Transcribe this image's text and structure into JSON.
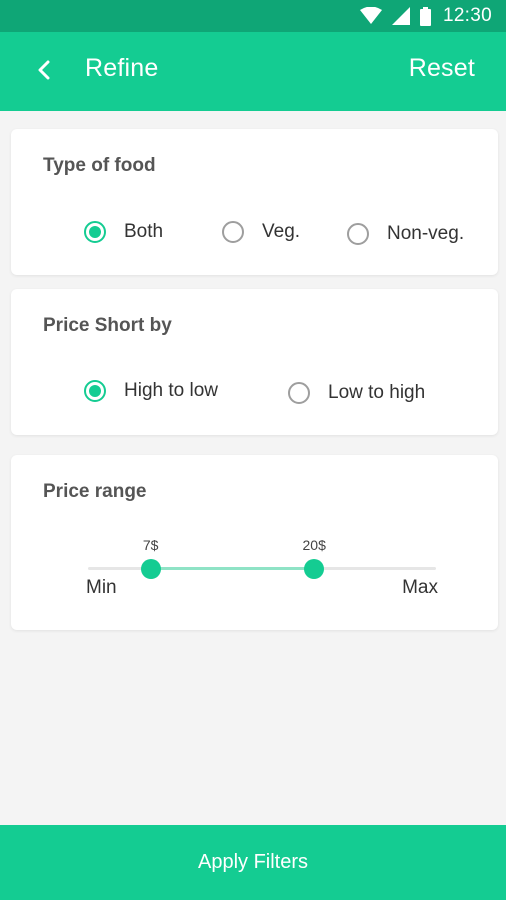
{
  "status_bar": {
    "time": "12:30",
    "icons": [
      "wifi-icon",
      "signal-icon",
      "battery-icon"
    ]
  },
  "app_bar": {
    "back_icon": "chevron-left-icon",
    "title": "Refine",
    "reset_label": "Reset"
  },
  "food_type": {
    "title": "Type of food",
    "options": [
      {
        "label": "Both",
        "checked": true
      },
      {
        "label": "Veg.",
        "checked": false
      },
      {
        "label": "Non-veg.",
        "checked": false
      }
    ]
  },
  "price_sort": {
    "title": "Price Short by",
    "options": [
      {
        "label": "High to low",
        "checked": true
      },
      {
        "label": "Low to high",
        "checked": false
      }
    ]
  },
  "price_range": {
    "title": "Price range",
    "min_label": "Min",
    "max_label": "Max",
    "low_value_label": "7$",
    "high_value_label": "20$",
    "low_fraction": 0.18,
    "high_fraction": 0.65
  },
  "footer": {
    "apply_label": "Apply Filters"
  },
  "colors": {
    "accent": "#14cc92",
    "status_bar": "#0fa676",
    "background": "#f4f4f4"
  }
}
